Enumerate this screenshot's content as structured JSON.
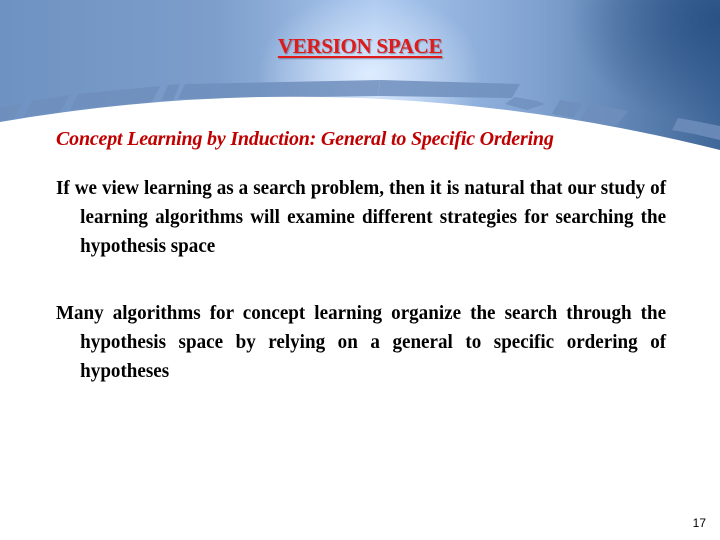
{
  "slide": {
    "title": "VERSION SPACE",
    "subtitle": "Concept Learning by Induction: General to Specific Ordering",
    "paragraphs": [
      "If we view learning as a search problem, then it is natural that our study of learning algorithms will examine different strategies for searching the hypothesis space",
      "Many algorithms for concept learning organize the search through the hypothesis space by relying on a general to specific ordering of hypotheses"
    ],
    "page_number": "17"
  },
  "colors": {
    "title": "#e01b1b",
    "subtitle": "#c00000",
    "body_text": "#000000",
    "header_blue": "#7d9ecb"
  }
}
